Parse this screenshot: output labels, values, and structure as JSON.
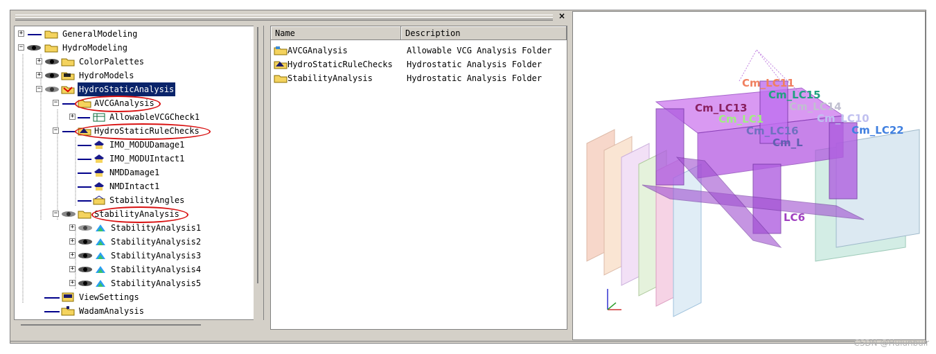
{
  "tree": {
    "items": [
      {
        "label": "GeneralModeling"
      },
      {
        "label": "HydroModeling"
      },
      {
        "label": "ColorPalettes"
      },
      {
        "label": "HydroModels"
      },
      {
        "label": "HydroStaticAnalysis"
      },
      {
        "label": "AVCGAnalysis"
      },
      {
        "label": "AllowableVCGCheck1"
      },
      {
        "label": "HydroStaticRuleChecks"
      },
      {
        "label": "IMO_MODUDamage1"
      },
      {
        "label": "IMO_MODUIntact1"
      },
      {
        "label": "NMDDamage1"
      },
      {
        "label": "NMDIntact1"
      },
      {
        "label": "StabilityAngles"
      },
      {
        "label": "StabilityAnalysis"
      },
      {
        "label": "StabilityAnalysis1"
      },
      {
        "label": "StabilityAnalysis2"
      },
      {
        "label": "StabilityAnalysis3"
      },
      {
        "label": "StabilityAnalysis4"
      },
      {
        "label": "StabilityAnalysis5"
      },
      {
        "label": "ViewSettings"
      },
      {
        "label": "WadamAnalysis"
      }
    ]
  },
  "list": {
    "columns": {
      "name": "Name",
      "description": "Description"
    },
    "rows": [
      {
        "name": "AVCGAnalysis",
        "description": "Allowable VCG Analysis Folder"
      },
      {
        "name": "HydroStaticRuleChecks",
        "description": "Hydrostatic Analysis Folder"
      },
      {
        "name": "StabilityAnalysis",
        "description": "Hydrostatic Analysis Folder"
      }
    ]
  },
  "view3d": {
    "labels": [
      "Cm_LC11",
      "Cm_LC15",
      "Cm_LC13",
      "Cm_LC14",
      "Cm_LC10",
      "Cm_LC1",
      "Cm_LC16",
      "Cm_LC22",
      "Cm_L",
      "LC6"
    ]
  },
  "pane": {
    "close_label": "×"
  },
  "watermark": "CSDN @Hulunbuir",
  "colors": {
    "selection": "#0a246a",
    "folder": "#f4d35e",
    "highlight_ring": "#d81010",
    "panel": "#d4d0c8"
  }
}
